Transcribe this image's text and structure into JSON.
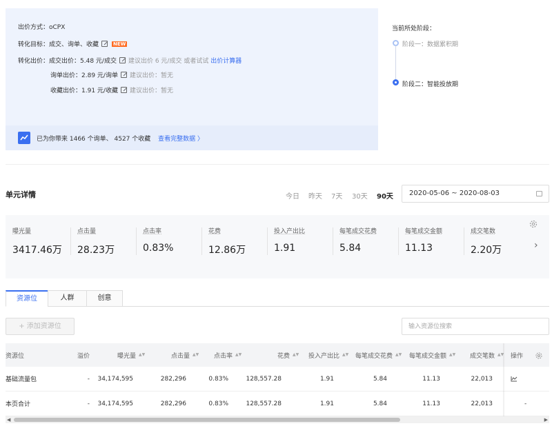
{
  "bid": {
    "method_label": "出价方式：",
    "method_value": "oCPX",
    "target_label": "转化目标：",
    "target_value": "成交、询单、收藏",
    "new_badge": "NEW",
    "conversion_bid_label": "转化出价：",
    "rows": [
      {
        "label": "成交出价：",
        "value": "5.48 元/成交",
        "suggest": "建议出价 6 元/成交",
        "extra": "或者试试",
        "link": "出价计算器"
      },
      {
        "label": "询单出价：",
        "value": "2.89 元/询单",
        "suggest": "建议出价：暂无"
      },
      {
        "label": "收藏出价：",
        "value": "1.91 元/收藏",
        "suggest": "建议出价：暂无"
      }
    ],
    "footer_text": "已为你带来 1466 个询单、 4527 个收藏",
    "footer_link": "查看完整数据 〉"
  },
  "stage": {
    "title": "当前所处阶段：",
    "stage1": "阶段一：数据累积期",
    "stage2": "阶段二：智能投放期"
  },
  "unit": {
    "title": "单元详情",
    "ranges": [
      "今日",
      "昨天",
      "7天",
      "30天",
      "90天"
    ],
    "active_range": "90天",
    "date_range": "2020-05-06 ~ 2020-08-03"
  },
  "metrics": [
    {
      "label": "曝光量",
      "value": "3417.46万"
    },
    {
      "label": "点击量",
      "value": "28.23万"
    },
    {
      "label": "点击率",
      "value": "0.83%"
    },
    {
      "label": "花费",
      "value": "12.86万"
    },
    {
      "label": "投入产出比",
      "value": "1.91"
    },
    {
      "label": "每笔成交花费",
      "value": "5.84"
    },
    {
      "label": "每笔成交金额",
      "value": "11.13"
    },
    {
      "label": "成交笔数",
      "value": "2.20万"
    }
  ],
  "tabs": [
    "资源位",
    "人群",
    "创意"
  ],
  "toolbar": {
    "add_label": "+ 添加资源位",
    "search_placeholder": "输入资源位搜索"
  },
  "table": {
    "headers": [
      "资源位",
      "溢价",
      "曝光量",
      "点击量",
      "点击率",
      "花费",
      "投入产出比",
      "每笔成交花费",
      "每笔成交金额",
      "成交笔数",
      "操作"
    ],
    "rows": [
      [
        "基础流量包",
        "-",
        "34,174,595",
        "282,296",
        "0.83%",
        "128,557.28",
        "1.91",
        "5.84",
        "11.13",
        "22,013"
      ],
      [
        "本页合计",
        "-",
        "34,174,595",
        "282,296",
        "0.83%",
        "128,557.28",
        "1.91",
        "5.84",
        "11.13",
        "22,013",
        "-"
      ]
    ]
  },
  "colors": {
    "accent": "#3a6ff0",
    "badge": "#ff6b21",
    "panel_bg": "#eef3fd"
  }
}
